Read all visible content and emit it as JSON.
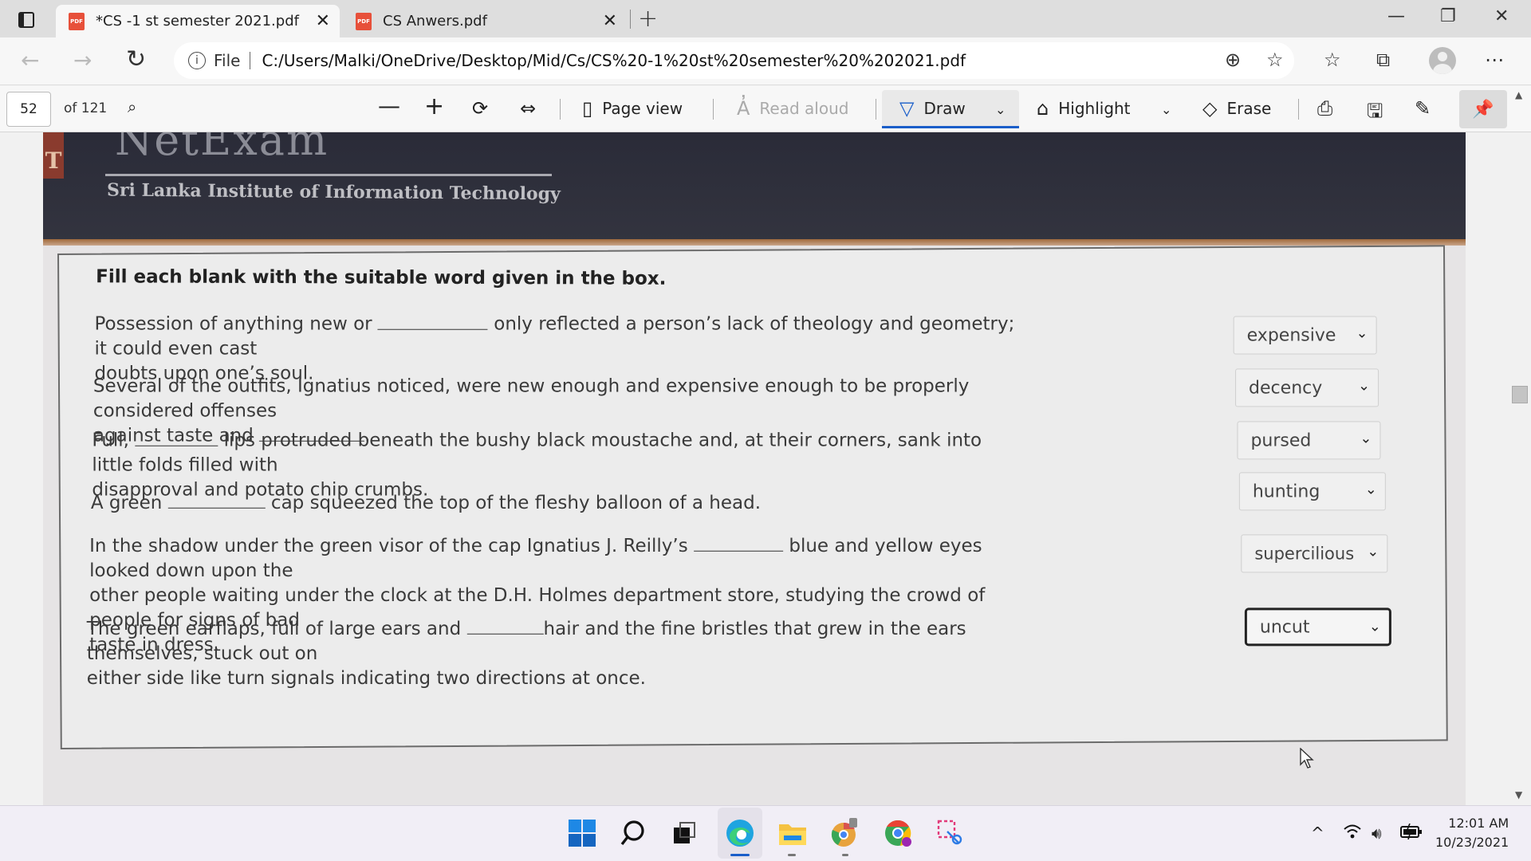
{
  "tabs": [
    {
      "label": "*CS -1 st semester 2021.pdf",
      "icon": "pdf-icon",
      "active": true
    },
    {
      "label": "CS Anwers.pdf",
      "icon": "pdf-icon",
      "active": false
    }
  ],
  "address": {
    "scheme_label": "File",
    "url": "C:/Users/Malki/OneDrive/Desktop/Mid/Cs/CS%20-1%20st%20semester%20%202021.pdf"
  },
  "pdf_toolbar": {
    "current_page": "52",
    "total_pages": "of 121",
    "page_view": "Page view",
    "read_aloud": "Read aloud",
    "draw": "Draw",
    "highlight": "Highlight",
    "erase": "Erase"
  },
  "document": {
    "header_title": "NetExam",
    "header_subtitle": "Sri Lanka Institute of Information Technology",
    "header_mark": "T",
    "instruction": "Fill each blank with the suitable word given in the box.",
    "questions": [
      {
        "part1": "Possession of anything new or ",
        "part2": " only reflected a person’s lack of theology and geometry; it could even cast",
        "line2": "doubts upon one’s soul.",
        "answer": "expensive"
      },
      {
        "part1": "Several of the outfits, Ignatius noticed, were new enough and expensive enough to be properly considered offenses",
        "line2a": "against taste and ",
        "line2b": ".",
        "answer": "decency"
      },
      {
        "part1": "Full, ",
        "part2": " lips protruded beneath the bushy black moustache and, at their corners, sank into little folds filled with",
        "line2": "disapproval and potato chip crumbs.",
        "answer": "pursed"
      },
      {
        "part1": "A green ",
        "part2": " cap squeezed the top of the fleshy balloon of a head.",
        "answer": "hunting"
      },
      {
        "part1": "In the shadow under the green visor of the cap Ignatius J. Reilly’s ",
        "part2": " blue and yellow eyes looked down upon the",
        "line2": "other people waiting under the clock at the D.H. Holmes department store, studying the crowd of people for signs of bad",
        "line3": "taste in dress.",
        "answer": "supercilious"
      },
      {
        "part1": "The green earflaps, full of large ears and ",
        "part2": "hair and the fine bristles that grew in the ears themselves, stuck out on",
        "line2": "either side like turn signals indicating two directions at once.",
        "answer": "uncut"
      }
    ]
  },
  "taskbar": {
    "apps": [
      "windows-start-icon",
      "search-icon",
      "task-view-icon",
      "edge-icon",
      "file-explorer-icon",
      "chrome-canary-icon",
      "chrome-icon",
      "snipping-tool-icon"
    ],
    "time": "12:01 AM",
    "date": "10/23/2021"
  },
  "colors": {
    "pdf_red": "#e7503a",
    "active_underline": "#1a5ec9",
    "banner": "#2a2b38"
  }
}
